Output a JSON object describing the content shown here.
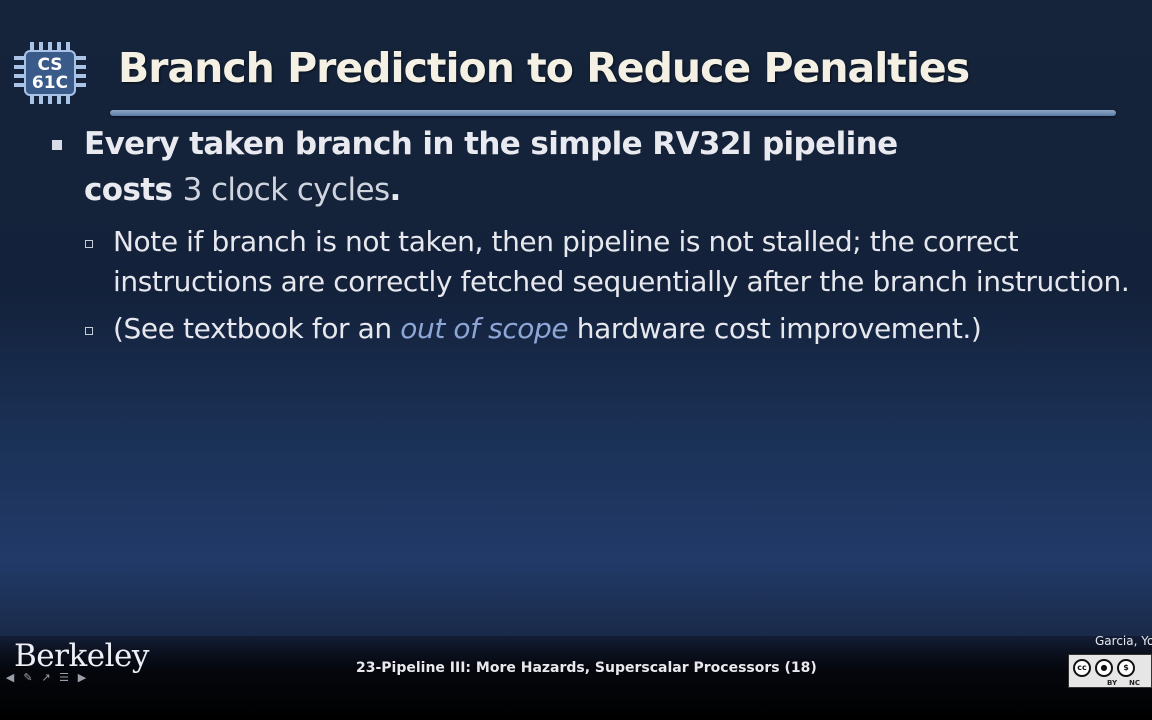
{
  "logo": {
    "text_line1": "CS",
    "text_line2": "61C"
  },
  "title": "Branch Prediction to Reduce Penalties",
  "bullets": {
    "main": {
      "line1": "Every taken branch in the simple RV32I pipeline",
      "line2_strong": "costs ",
      "line2_light": "3 clock cycles",
      "line2_end": "."
    },
    "sub1": {
      "line1": "Note if branch is not taken, then pipeline is not stalled; the correct",
      "line2": "instructions are correctly fetched sequentially after the branch instruction."
    },
    "sub2": {
      "prefix": "(See textbook for an ",
      "emphasis": "out of scope",
      "suffix": " hardware cost improvement.)"
    }
  },
  "footer": {
    "institution": "Berkeley",
    "lecture": "23-Pipeline III: More Hazards, Superscalar Processors (18)",
    "authors": "Garcia, Yo",
    "license": {
      "cc": "cc",
      "by": "BY",
      "nc": "NC"
    }
  },
  "colors": {
    "title": "#f4f1e4",
    "body_text": "#e9eaf0",
    "emphasis": "#8ea6d6",
    "background_top": "#15243a",
    "background_band": "#213a68"
  },
  "icons": {
    "nav": [
      "prev-icon",
      "edit-icon",
      "pointer-icon",
      "menu-icon",
      "next-icon"
    ]
  }
}
